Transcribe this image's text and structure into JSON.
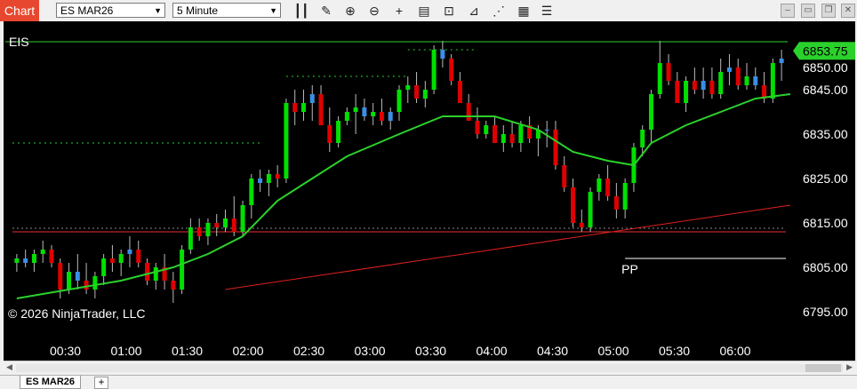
{
  "toolbar": {
    "chart_tab": "Chart",
    "instrument": "ES MAR26",
    "interval": "5 Minute",
    "icons": [
      "bars-icon",
      "pencil-icon",
      "zoom-in-icon",
      "zoom-out-icon",
      "crosshair-icon",
      "data-box-icon",
      "strategy-icon",
      "indicator-icon",
      "template-icon",
      "properties-icon"
    ]
  },
  "chart": {
    "symbol_label": "EIS",
    "copyright": "© 2026 NinjaTrader, LLC",
    "pp_label": "PP",
    "last_price": "6853.75",
    "colors": {
      "up": "#00e000",
      "down": "#e00000",
      "neutral": "#3a8ee6",
      "ma": "#2bd12b",
      "trend": "#e02020",
      "pivot": "#e83030"
    }
  },
  "chart_data": {
    "type": "candlestick",
    "y_ticks": [
      "6850.00",
      "6845.00",
      "6835.00",
      "6825.00",
      "6815.00",
      "6805.00",
      "6795.00"
    ],
    "x_ticks": [
      "00:30",
      "01:00",
      "01:30",
      "02:00",
      "02:30",
      "03:00",
      "03:30",
      "04:00",
      "04:30",
      "05:00",
      "05:30",
      "06:00"
    ],
    "ylim": [
      6792,
      6856
    ],
    "candles": [
      [
        6806,
        6808,
        6804,
        6807
      ],
      [
        6807,
        6809,
        6805,
        6806
      ],
      [
        6806,
        6809,
        6804,
        6808
      ],
      [
        6808,
        6811,
        6806,
        6809
      ],
      [
        6809,
        6810,
        6805,
        6806
      ],
      [
        6806,
        6807,
        6798,
        6800
      ],
      [
        6800,
        6806,
        6799,
        6804
      ],
      [
        6804,
        6808,
        6800,
        6802
      ],
      [
        6802,
        6806,
        6799,
        6800
      ],
      [
        6800,
        6804,
        6798,
        6803
      ],
      [
        6803,
        6808,
        6801,
        6807
      ],
      [
        6807,
        6810,
        6804,
        6806
      ],
      [
        6806,
        6809,
        6803,
        6808
      ],
      [
        6808,
        6812,
        6805,
        6809
      ],
      [
        6809,
        6811,
        6805,
        6806
      ],
      [
        6806,
        6807,
        6801,
        6802
      ],
      [
        6802,
        6806,
        6800,
        6805
      ],
      [
        6805,
        6808,
        6800,
        6802
      ],
      [
        6802,
        6804,
        6797,
        6800
      ],
      [
        6800,
        6810,
        6799,
        6809
      ],
      [
        6809,
        6816,
        6808,
        6814
      ],
      [
        6814,
        6816,
        6811,
        6812
      ],
      [
        6812,
        6816,
        6810,
        6815
      ],
      [
        6815,
        6817,
        6812,
        6814
      ],
      [
        6814,
        6818,
        6813,
        6816
      ],
      [
        6816,
        6821,
        6812,
        6813
      ],
      [
        6813,
        6820,
        6812,
        6819
      ],
      [
        6819,
        6826,
        6816,
        6825
      ],
      [
        6825,
        6827,
        6822,
        6824
      ],
      [
        6824,
        6827,
        6821,
        6826
      ],
      [
        6826,
        6828,
        6823,
        6825
      ],
      [
        6825,
        6843,
        6824,
        6842
      ],
      [
        6842,
        6845,
        6837,
        6840
      ],
      [
        6840,
        6845,
        6838,
        6842
      ],
      [
        6842,
        6846,
        6838,
        6844
      ],
      [
        6844,
        6846,
        6838,
        6837
      ],
      [
        6837,
        6841,
        6831,
        6833
      ],
      [
        6833,
        6839,
        6832,
        6838
      ],
      [
        6838,
        6841,
        6837,
        6840
      ],
      [
        6840,
        6844,
        6835,
        6841
      ],
      [
        6841,
        6843,
        6838,
        6839
      ],
      [
        6839,
        6842,
        6837,
        6840
      ],
      [
        6840,
        6843,
        6837,
        6838
      ],
      [
        6838,
        6841,
        6836,
        6840
      ],
      [
        6840,
        6846,
        6838,
        6845
      ],
      [
        6845,
        6848,
        6842,
        6846
      ],
      [
        6846,
        6849,
        6842,
        6843
      ],
      [
        6843,
        6847,
        6841,
        6845
      ],
      [
        6845,
        6855,
        6844,
        6854
      ],
      [
        6854,
        6856,
        6850,
        6852
      ],
      [
        6852,
        6853,
        6846,
        6847
      ],
      [
        6847,
        6849,
        6843,
        6842
      ],
      [
        6842,
        6844,
        6838,
        6838
      ],
      [
        6838,
        6841,
        6834,
        6835
      ],
      [
        6835,
        6838,
        6834,
        6837
      ],
      [
        6837,
        6839,
        6833,
        6833
      ],
      [
        6833,
        6837,
        6831,
        6835
      ],
      [
        6835,
        6838,
        6832,
        6833
      ],
      [
        6833,
        6838,
        6831,
        6837
      ],
      [
        6837,
        6839,
        6833,
        6834
      ],
      [
        6834,
        6837,
        6830,
        6836
      ],
      [
        6836,
        6838,
        6832,
        6836
      ],
      [
        6836,
        6838,
        6827,
        6828
      ],
      [
        6828,
        6830,
        6822,
        6823
      ],
      [
        6823,
        6825,
        6814,
        6815
      ],
      [
        6815,
        6818,
        6813,
        6814
      ],
      [
        6814,
        6823,
        6813,
        6822
      ],
      [
        6822,
        6826,
        6820,
        6825
      ],
      [
        6825,
        6828,
        6820,
        6821
      ],
      [
        6821,
        6824,
        6816,
        6818
      ],
      [
        6818,
        6825,
        6816,
        6824
      ],
      [
        6824,
        6833,
        6822,
        6832
      ],
      [
        6832,
        6837,
        6830,
        6836
      ],
      [
        6836,
        6845,
        6833,
        6844
      ],
      [
        6844,
        6856,
        6843,
        6851
      ],
      [
        6851,
        6853,
        6846,
        6847
      ],
      [
        6847,
        6849,
        6842,
        6842
      ],
      [
        6842,
        6848,
        6840,
        6847
      ],
      [
        6847,
        6850,
        6844,
        6845
      ],
      [
        6845,
        6850,
        6843,
        6847
      ],
      [
        6847,
        6850,
        6843,
        6844
      ],
      [
        6844,
        6852,
        6843,
        6849
      ],
      [
        6849,
        6853,
        6846,
        6850
      ],
      [
        6850,
        6852,
        6845,
        6846
      ],
      [
        6846,
        6851,
        6845,
        6848
      ],
      [
        6848,
        6850,
        6845,
        6846
      ],
      [
        6846,
        6849,
        6842,
        6843
      ],
      [
        6843,
        6852,
        6842,
        6851
      ],
      [
        6851,
        6854,
        6847,
        6852
      ]
    ],
    "ma": [
      [
        0,
        6798
      ],
      [
        6,
        6800
      ],
      [
        12,
        6802
      ],
      [
        18,
        6805
      ],
      [
        22,
        6808
      ],
      [
        26,
        6812
      ],
      [
        30,
        6820
      ],
      [
        34,
        6825
      ],
      [
        38,
        6830
      ],
      [
        44,
        6835
      ],
      [
        49,
        6839
      ],
      [
        55,
        6839
      ],
      [
        60,
        6836
      ],
      [
        64,
        6831
      ],
      [
        68,
        6829
      ],
      [
        71,
        6828
      ],
      [
        73,
        6833
      ],
      [
        77,
        6837
      ],
      [
        81,
        6840
      ],
      [
        85,
        6843
      ],
      [
        89,
        6844
      ]
    ],
    "trendline": [
      [
        24,
        6800
      ],
      [
        89,
        6819
      ]
    ],
    "pivot_level": 6813,
    "pp_level": 6807
  }
}
